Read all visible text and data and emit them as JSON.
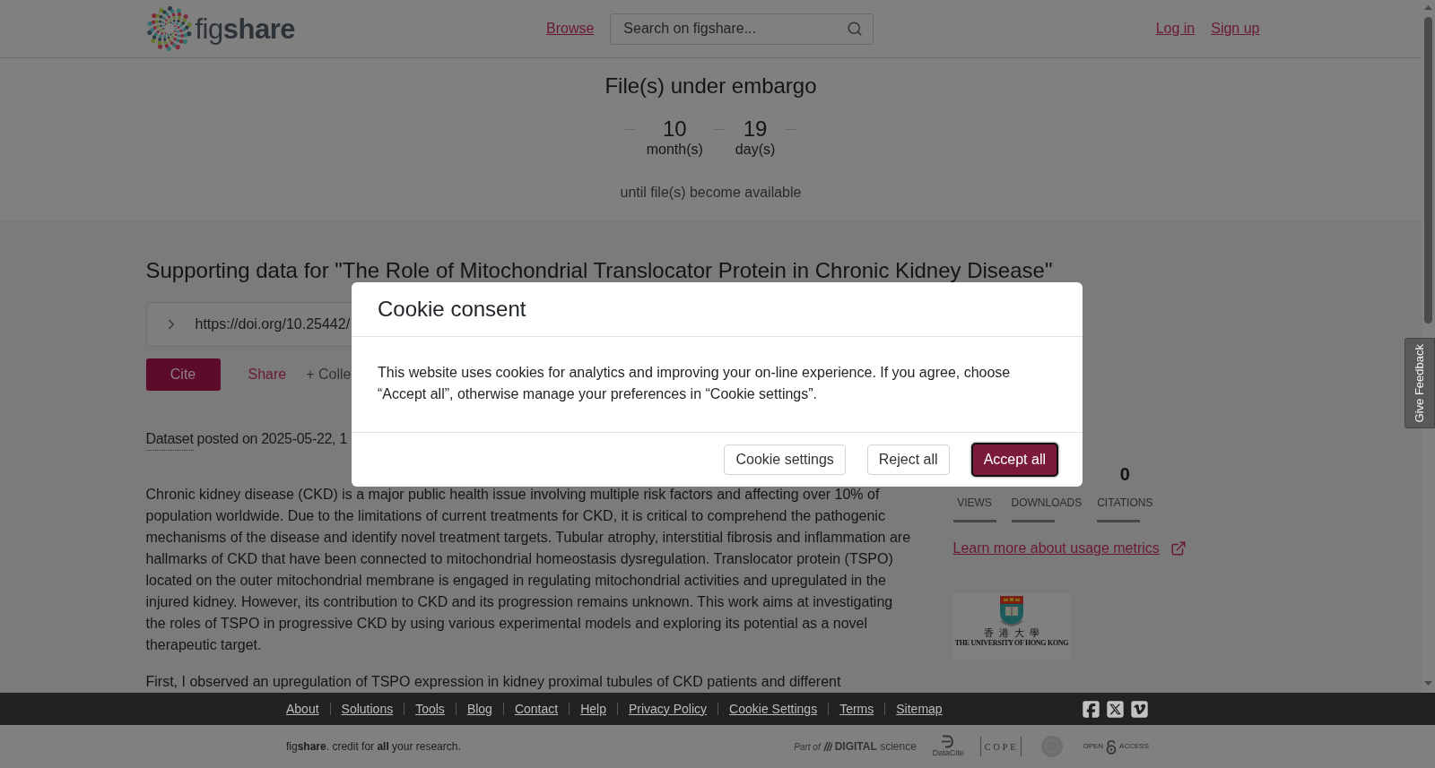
{
  "header": {
    "logo": "fig**share**",
    "nav_link": "Browse",
    "search": {
      "placeholder": "Search on figshare..."
    },
    "auth_links": [
      "Log in",
      "Sign up"
    ]
  },
  "embargo": {
    "title": "File(s) under embargo",
    "countdown": [
      {
        "value": "10",
        "unit": "month(s)"
      },
      {
        "value": "19",
        "unit": "day(s)"
      }
    ],
    "note": "until file(s) become available"
  },
  "item": {
    "title": "Supporting data for \"The Role of Mitochondrial Translocator Protein in Chronic Kidney Disease\"",
    "doi": "https://doi.org/10.25442/",
    "actions": [
      {
        "label": "Cite",
        "kind": "primary"
      },
      {
        "label": "Share",
        "kind": "link"
      },
      {
        "label": "+ Colle",
        "kind": "plain"
      }
    ],
    "posted": {
      "type_label": "Dataset",
      "text": "posted on 2025-05-22, 1"
    },
    "description": [
      "Chronic kidney disease (CKD) is a major public health issue involving multiple risk factors and affecting over 10% of population worldwide. Due to the limitations of current treatments for CKD, it is critical to comprehend the pathogenic mechanisms of the disease and identify novel treatment targets. Tubular atrophy, interstitial fibrosis and inflammation are hallmarks of CKD that have been connected to mitochondrial homeostasis dysregulation. Translocator protein (TSPO) located on the outer mitochondrial membrane is engaged in regulating mitochondrial activities and upregulated in the injured kidney. However, its contribution to CKD and its progression remains unknown. This work aims at investigating the roles of TSPO in progressive CKD by using various experimental models and exploring its potential as a novel therapeutic target.",
      "First, I observed an upregulation of TSPO expression in kidney proximal tubules of CKD patients and different"
    ]
  },
  "metrics": {
    "stats": [
      {
        "label": "VIEWS"
      },
      {
        "label": "DOWNLOADS"
      },
      {
        "value": "0",
        "label": "CITATIONS"
      }
    ],
    "learn_more_link": "Learn more about usage metrics"
  },
  "institution_logo": {
    "chinese_name": "香港大學",
    "english_name": "THE UNIVERSITY OF HONG KONG"
  },
  "feedback_tab": "Give Feedback",
  "footer": {
    "links": [
      "About",
      "Solutions",
      "Tools",
      "Blog",
      "Contact",
      "Help",
      "Privacy Policy",
      "Cookie Settings",
      "Terms",
      "Sitemap"
    ],
    "tagline": "fig**share**. credit for **all** your research.",
    "partners": [
      {
        "kind": "digital_science",
        "texts": [
          "Part of",
          "**DIGITAL** science"
        ]
      },
      {
        "kind": "datacite",
        "texts": [
          "DataCite"
        ]
      },
      {
        "kind": "cope",
        "texts": [
          "COPE"
        ]
      },
      {
        "kind": "badge"
      },
      {
        "kind": "open_access",
        "texts": [
          "OPEN",
          "ACCESS"
        ]
      }
    ]
  },
  "cookie_dialog": {
    "title": "Cookie consent",
    "message": "This website uses cookies for analytics and improving your on-line experience. If you agree, choose “Accept all”, otherwise manage your preferences in “Cookie settings”.",
    "buttons": [
      {
        "label": "Cookie settings",
        "kind": "secondary",
        "focused": false
      },
      {
        "label": "Reject all",
        "kind": "secondary",
        "focused": false
      },
      {
        "label": "Accept all",
        "kind": "primary",
        "focused": true
      }
    ]
  }
}
